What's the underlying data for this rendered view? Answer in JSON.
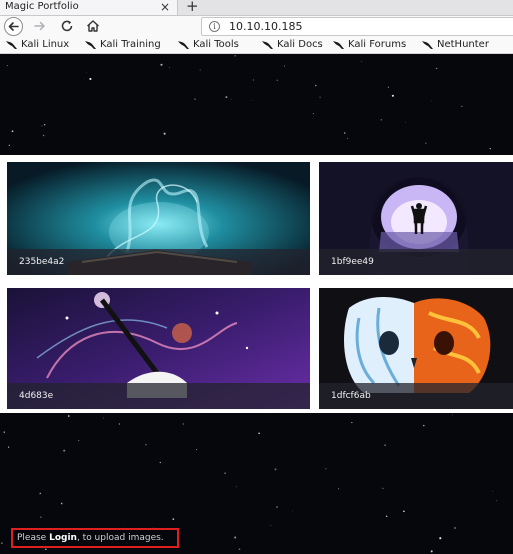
{
  "browser": {
    "tab_title": "Magic Portfolio",
    "tab_close": "×",
    "new_tab": "+",
    "info_glyph": "i",
    "url": "10.10.10.185"
  },
  "bookmarks": [
    {
      "label": "Kali Linux",
      "icon": "kali-dragon-icon"
    },
    {
      "label": "Kali Training",
      "icon": "kali-dragon-icon"
    },
    {
      "label": "Kali Tools",
      "icon": "kali-dragon-icon"
    },
    {
      "label": "Kali Docs",
      "icon": "kali-dragon-icon"
    },
    {
      "label": "Kali Forums",
      "icon": "kali-dragon-icon"
    },
    {
      "label": "NetHunter",
      "icon": "kali-dragon-icon"
    }
  ],
  "gallery": [
    {
      "caption": "235be4a2",
      "image": "magic-book"
    },
    {
      "caption": "1bf9ee49",
      "image": "cave-silhouette"
    },
    {
      "caption": "4d683e",
      "image": "magic-wand"
    },
    {
      "caption": "1dfcf6ab",
      "image": "fire-ice-skull"
    }
  ],
  "footer": {
    "prefix": "Please ",
    "link": "Login",
    "suffix": ", to upload images."
  },
  "colors": {
    "highlight_border": "#e02020",
    "page_background": "#06060d"
  }
}
